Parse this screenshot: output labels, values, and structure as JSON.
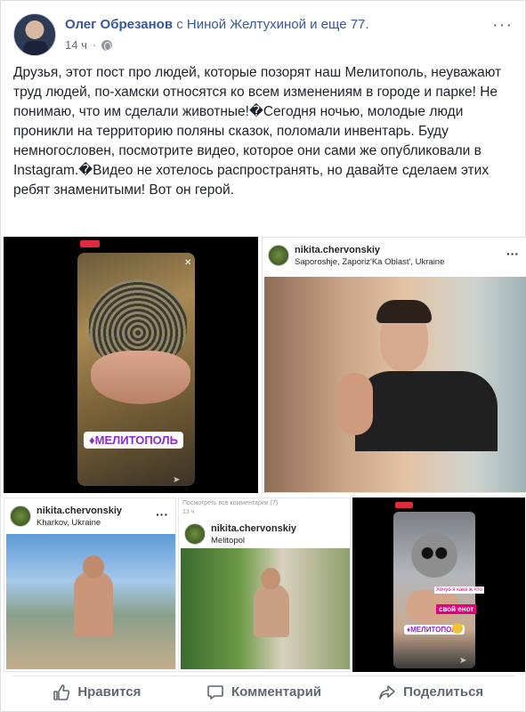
{
  "post": {
    "author": "Олег Обрезанов",
    "with_prefix": "с",
    "tagged": "Ниной Желтухиной и еще 77.",
    "time": "14 ч",
    "text": "Друзья, этот пост про людей, которые позорят наш Мелитополь, неуважают труд людей, по-хамски относятся ко всем изменениям в городе и парке! Не понимаю, что им сделали животные!�Сегодня ночью, молодые люди проникли на территорию поляны сказок, поломали инвентарь. Буду немногословен, посмотрите видео, которое они сами же опубликовали в Instagram.�Видео не хотелось распространять, но давайте сделаем этих ребят знаменитыми! Вот он герой."
  },
  "photos": {
    "t1": {
      "caption": "♦МЕЛИТОПОЛЬ"
    },
    "t2": {
      "user": "nikita.chervonskiy",
      "location": "Saporoshje, Zaporiz'Ka Oblast', Ukraine"
    },
    "t3": {
      "user": "nikita.chervonskiy",
      "location": "Kharkov, Ukraine"
    },
    "t4": {
      "top_note": "Посмотреть все комментарии (7)",
      "top_time": "13 ч",
      "user": "nikita.chervonskiy",
      "location": "Melitopol"
    },
    "t5": {
      "sticker1": "Хочуо я како ж что",
      "sticker2": "свой енот",
      "caption": "♦МЕЛИТОПОЛЬ"
    }
  },
  "actions": {
    "like": "Нравится",
    "comment": "Комментарий",
    "share": "Поделиться"
  },
  "icons": [
    "globe-icon",
    "more-icon",
    "like-icon",
    "comment-icon",
    "share-icon",
    "send-icon",
    "close-icon"
  ],
  "colors": {
    "link": "#365899",
    "meta": "#616770",
    "live": "#e02b3c",
    "caption": "#8a2bd6"
  }
}
